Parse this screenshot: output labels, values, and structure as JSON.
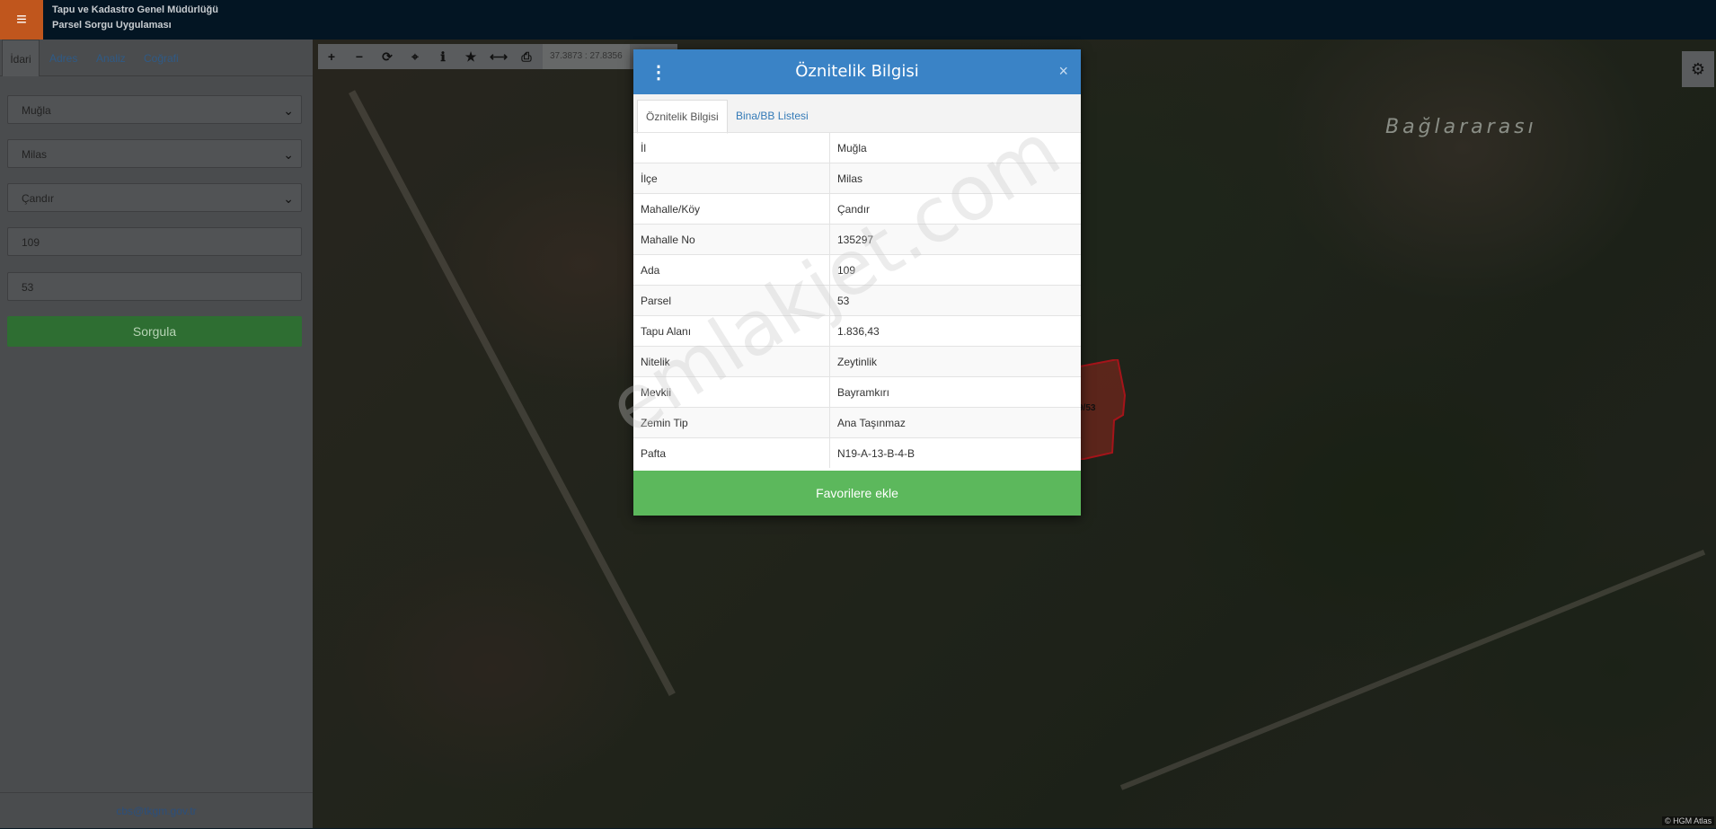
{
  "header": {
    "org_line1": "Tapu ve Kadastro Genel Müdürlüğü",
    "org_line2": "Parsel Sorgu Uygulaması",
    "menu_icon": "hamburger-icon"
  },
  "sidebar": {
    "tabs": [
      "İdari",
      "Adres",
      "Analiz",
      "Coğrafi"
    ],
    "active_tab": "İdari",
    "province": "Muğla",
    "district": "Milas",
    "neighborhood": "Çandır",
    "block": "109",
    "parcel": "53",
    "query_label": "Sorgula",
    "footer_email": "cbs@tkgm.gov.tr"
  },
  "map": {
    "toolbar_icons": [
      "zoom-in-icon",
      "zoom-out-icon",
      "refresh-icon",
      "locate-icon",
      "info-icon",
      "star-icon",
      "measure-icon",
      "print-icon"
    ],
    "toolbar_glyphs": [
      "+",
      "−",
      "⟳",
      "⌖",
      "ℹ",
      "★",
      "⟷",
      "⎙"
    ],
    "coordinates": "37.3873 : 27.8356",
    "place_label": "Bağlararası",
    "parcel_label": "9/53",
    "attribution": "© HGM Atlas"
  },
  "modal": {
    "title": "Öznitelik Bilgisi",
    "close": "×",
    "tabs": [
      "Öznitelik Bilgisi",
      "Bina/BB Listesi"
    ],
    "rows": [
      {
        "key": "İl",
        "value": "Muğla"
      },
      {
        "key": "İlçe",
        "value": "Milas"
      },
      {
        "key": "Mahalle/Köy",
        "value": "Çandır"
      },
      {
        "key": "Mahalle No",
        "value": "135297"
      },
      {
        "key": "Ada",
        "value": "109"
      },
      {
        "key": "Parsel",
        "value": "53"
      },
      {
        "key": "Tapu Alanı",
        "value": "1.836,43"
      },
      {
        "key": "Nitelik",
        "value": "Zeytinlik"
      },
      {
        "key": "Mevkii",
        "value": "Bayramkırı"
      },
      {
        "key": "Zemin Tip",
        "value": "Ana Taşınmaz"
      },
      {
        "key": "Pafta",
        "value": "N19-A-13-B-4-B"
      }
    ],
    "favorite_label": "Favorilere ekle"
  },
  "watermark": "emlakjet.com",
  "colors": {
    "header_bg": "#031523",
    "menu_bg": "#c0561d",
    "modal_header": "#3a83c6",
    "favorite_button": "#5cb85c",
    "query_button": "#2e6e32"
  }
}
